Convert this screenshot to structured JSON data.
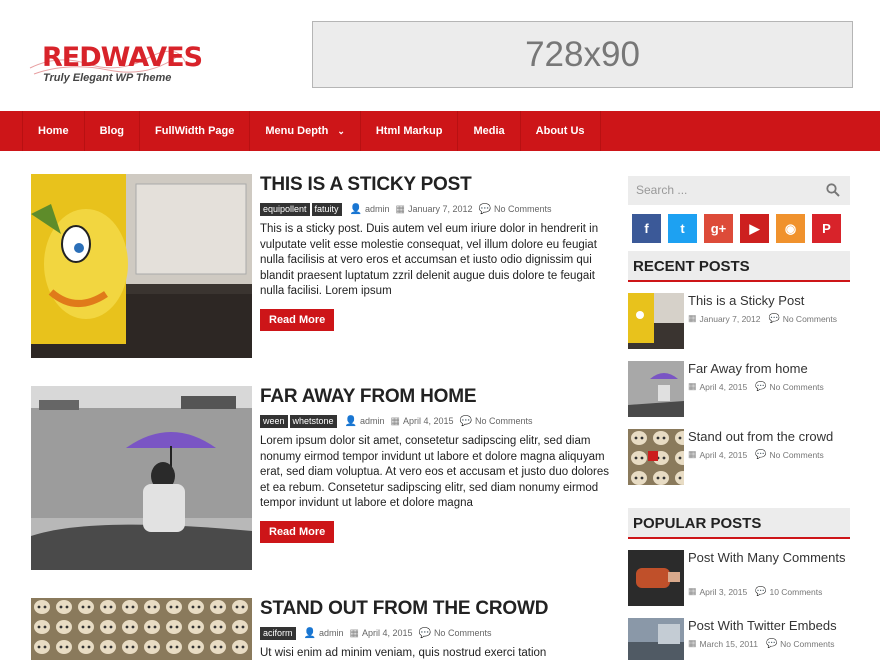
{
  "header": {
    "logo_text": "REDWAVES",
    "logo_tagline": "Truly Elegant WP Theme",
    "ad_text": "728x90"
  },
  "nav": {
    "items": [
      "Home",
      "Blog",
      "FullWidth Page",
      "Menu Depth",
      "Html Markup",
      "Media",
      "About Us"
    ]
  },
  "posts": [
    {
      "title": "THIS IS A STICKY POST",
      "tags": [
        "equipollent",
        "fatuity"
      ],
      "author": "admin",
      "date": "January 7, 2012",
      "comments": "No Comments",
      "excerpt": "This is a sticky post. Duis autem vel eum iriure dolor in hendrerit in vulputate velit esse molestie consequat, vel illum dolore eu feugiat nulla facilisis at vero eros et accumsan et iusto odio dignissim qui blandit praesent luptatum zzril delenit augue duis dolore te feugait nulla facilisi. Lorem ipsum",
      "read_more": "Read More"
    },
    {
      "title": "FAR AWAY FROM HOME",
      "tags": [
        "ween",
        "whetstone"
      ],
      "author": "admin",
      "date": "April 4, 2015",
      "comments": "No Comments",
      "excerpt": " Lorem ipsum dolor sit amet, consetetur sadipscing elitr, sed diam nonumy eirmod tempor invidunt ut labore et dolore magna aliquyam erat, sed diam voluptua. At vero eos et accusam et justo duo dolores et ea rebum. Consetetur sadipscing elitr, sed diam nonumy eirmod tempor invidunt ut labore et dolore magna",
      "read_more": "Read More"
    },
    {
      "title": "STAND OUT FROM THE CROWD",
      "tags": [
        "aciform"
      ],
      "author": "admin",
      "date": "April 4, 2015",
      "comments": "No Comments",
      "excerpt": "Ut wisi enim ad minim veniam, quis nostrud exerci tation"
    }
  ],
  "sidebar": {
    "search_placeholder": "Search ...",
    "socials": [
      {
        "icon": "facebook-icon",
        "glyph": "f",
        "color": "#3b5998"
      },
      {
        "icon": "twitter-icon",
        "glyph": "t",
        "color": "#1da1f2"
      },
      {
        "icon": "google-plus-icon",
        "glyph": "g+",
        "color": "#dd4b39"
      },
      {
        "icon": "youtube-icon",
        "glyph": "▶",
        "color": "#cd201f"
      },
      {
        "icon": "rss-icon",
        "glyph": "◉",
        "color": "#f0922d"
      },
      {
        "icon": "pinterest-icon",
        "glyph": "P",
        "color": "#d8232a"
      }
    ],
    "recent_title": "RECENT POSTS",
    "recent": [
      {
        "title": "This is a Sticky Post",
        "date": "January 7, 2012",
        "comments": "No Comments"
      },
      {
        "title": "Far Away from home",
        "date": "April 4, 2015",
        "comments": "No Comments"
      },
      {
        "title": "Stand out from the crowd",
        "date": "April 4, 2015",
        "comments": "No Comments"
      }
    ],
    "popular_title": "POPULAR POSTS",
    "popular": [
      {
        "title": "Post With Many Comments",
        "date": "April 3, 2015",
        "comments": "10 Comments"
      },
      {
        "title": "Post With Twitter Embeds",
        "date": "March 15, 2011",
        "comments": "No Comments"
      }
    ]
  },
  "colors": {
    "accent": "#cd1518",
    "tag_bg": "#333333",
    "widget_bg": "#ececec"
  }
}
